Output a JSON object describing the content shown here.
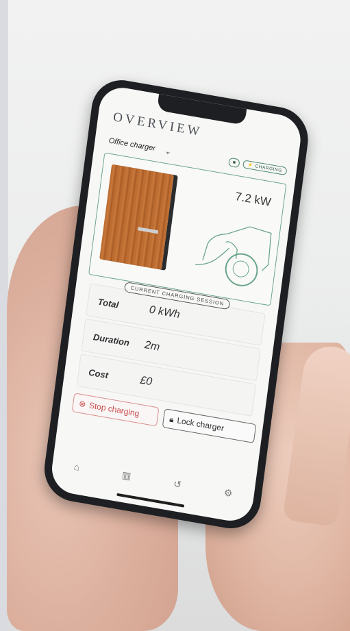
{
  "screen": {
    "title": "OVERVIEW",
    "charger": {
      "selected": "Office charger",
      "status": "⚡ CHARGING"
    },
    "hero": {
      "power": "7.2 kW"
    },
    "session": {
      "label": "CURRENT CHARGING SESSION",
      "stats": [
        {
          "label": "Total",
          "value": "0 kWh"
        },
        {
          "label": "Duration",
          "value": "2m"
        },
        {
          "label": "Cost",
          "value": "£0"
        }
      ]
    },
    "actions": {
      "stop_label": "Stop charging",
      "lock_label": "Lock charger"
    },
    "tabs": [
      {
        "icon": "home-icon",
        "active": true
      },
      {
        "icon": "stats-icon"
      },
      {
        "icon": "history-icon"
      },
      {
        "icon": "settings-icon"
      }
    ]
  },
  "colors": {
    "accent": "#4b8a6e",
    "stop": "#c94d4d",
    "charger_wood": "#b9692e"
  }
}
